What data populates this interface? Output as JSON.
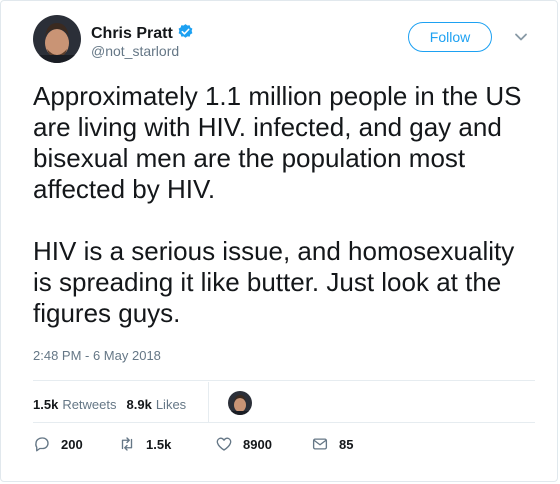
{
  "user": {
    "name": "Chris Pratt",
    "handle": "@not_starlord",
    "verified": true
  },
  "follow_label": "Follow",
  "tweet": {
    "paragraphs": [
      "Approximately 1.1 million people in the US are living with HIV. infected, and gay and bisexual men are the population most affected by HIV.",
      "HIV is a serious issue, and homosexuality is spreading it like butter. Just look at the figures guys."
    ],
    "timestamp": "2:48 PM - 6 May 2018"
  },
  "stats": {
    "retweets_count": "1.5k",
    "retweets_label": "Retweets",
    "likes_count": "8.9k",
    "likes_label": "Likes"
  },
  "actions": {
    "replies": "200",
    "retweets": "1.5k",
    "likes": "8900",
    "messages": "85"
  },
  "colors": {
    "accent": "#1da1f2",
    "text": "#14171a",
    "muted": "#657786",
    "border": "#e6ecf0"
  }
}
